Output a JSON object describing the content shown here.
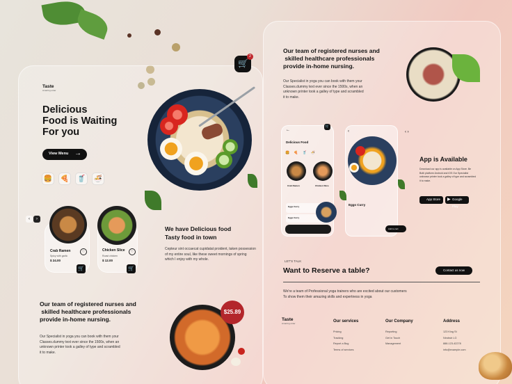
{
  "left": {
    "brand": "Taste",
    "brand_sub": "Amazing order",
    "hero_title": [
      "Delicious",
      "Food is Waiting",
      "For you"
    ],
    "view_menu": "View Menu",
    "cart_count": "2",
    "items": [
      {
        "name": "Crab Ramen",
        "desc": "Spicy with garlic",
        "price": "$ 24.00"
      },
      {
        "name": "Chicken Slice",
        "desc": "Roast chicken",
        "price": "$ 12.00"
      }
    ],
    "section2_title": [
      "We have Delicious food",
      "Tasty food in town"
    ],
    "section2_text": [
      "Cepteur sint occaecat cupidatat proident, taken possession",
      "of my entire soul, like these sweet mornings of spring",
      "which I enjoy with my whole."
    ],
    "section3_title": [
      "Our team of registered nurses and",
      " skilled healthcare professionals",
      "provide in-home nursing."
    ],
    "section3_text": [
      "Our Specialist  in yoga you can book with them your",
      "Classes.dummy text ever since the 1500s, when an",
      "unknown printer took a galley of type and scrambled",
      "it to make."
    ],
    "price_badge": "$25.89"
  },
  "right": {
    "top_title": [
      "Our team of registered nurses and",
      " skilled healthcare professionals",
      "provide in-home nursing."
    ],
    "top_text": [
      "Our Specialist  in yoga you can book with them your",
      "Classes.dummy text ever since the 1500s, when an",
      "unknown printer took a galley of type and scrambled",
      "it to make."
    ],
    "phone1_title": "Delicious Food",
    "phone1_items": [
      "Crab Ramen",
      "Chicken Slice"
    ],
    "phone1_list": [
      "Eggs Curry",
      "Eggs Curry"
    ],
    "phone2_title": "Eggs Curry",
    "phone2_btn": "Add to cart",
    "app_title": "App is Available",
    "app_text": [
      "Download our app is available on App Store. Be",
      "Both platform Android and iOS Our Specialist",
      "unknown printer took a galley of type and scrambled",
      "it to make."
    ],
    "app_store": "App Store",
    "google_play": "Google Play",
    "lets_talk": "LET'S TALK",
    "reserve_title": "Want to Reserve a table?",
    "contact_btn": "Contact us now",
    "reserve_text": [
      "We're a team of Professional yoga trainers who are excited about our customers",
      "To show them their amazing skills and expertness in yoga"
    ],
    "footer": {
      "brand": "Taste",
      "brand_sub": "Amazing order",
      "services_title": "Our services",
      "services": [
        "Pricing",
        "Tracking",
        "Report a Bug",
        "Terms of services"
      ],
      "company_title": "Our Company",
      "company": [
        "Reporting",
        "Get in Touch",
        "Management"
      ],
      "address_title": "Address",
      "address": [
        "123 King St",
        "Nindrub LG",
        "888-123-42278",
        "info@example.com"
      ]
    }
  }
}
